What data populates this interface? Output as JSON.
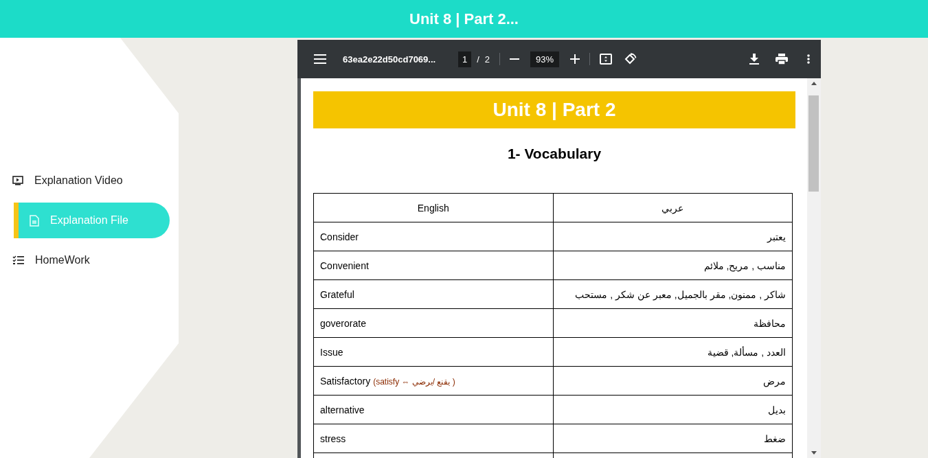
{
  "header": {
    "title": "Unit 8 | Part 2..."
  },
  "sidebar": {
    "items": [
      {
        "label": "Explanation Video",
        "kind": "video",
        "selected": false
      },
      {
        "label": "Explanation File",
        "kind": "file",
        "selected": true
      },
      {
        "label": "HomeWork",
        "kind": "list",
        "selected": false
      }
    ]
  },
  "viewer": {
    "filename": "63ea2e22d50cd7069...",
    "page": "1",
    "page_count": "2",
    "separator": "/",
    "zoom": "93%"
  },
  "document": {
    "banner": "Unit 8 | Part 2",
    "heading": "1- Vocabulary",
    "header_row": {
      "english": "English",
      "arabic": "عربي"
    },
    "rows": [
      {
        "english": "Consider",
        "arabic": "يعتبر"
      },
      {
        "english": "Convenient",
        "arabic": "مناسب , مريح, ملائم"
      },
      {
        "english": "Grateful",
        "arabic": "شاكر , ممنون, مقر بالجميل, معبر عن شكر , مستحب"
      },
      {
        "english": "goverorate",
        "arabic": "محافظة"
      },
      {
        "english": "Issue",
        "arabic": "العدد , مسألة, قضية"
      },
      {
        "english": "Satisfactory",
        "note": "(satisfy ⇔ يقنع /يرضي )",
        "arabic": "مرض"
      },
      {
        "english": "alternative",
        "arabic": "بديل"
      },
      {
        "english": "stress",
        "arabic": "ضغط"
      }
    ]
  }
}
